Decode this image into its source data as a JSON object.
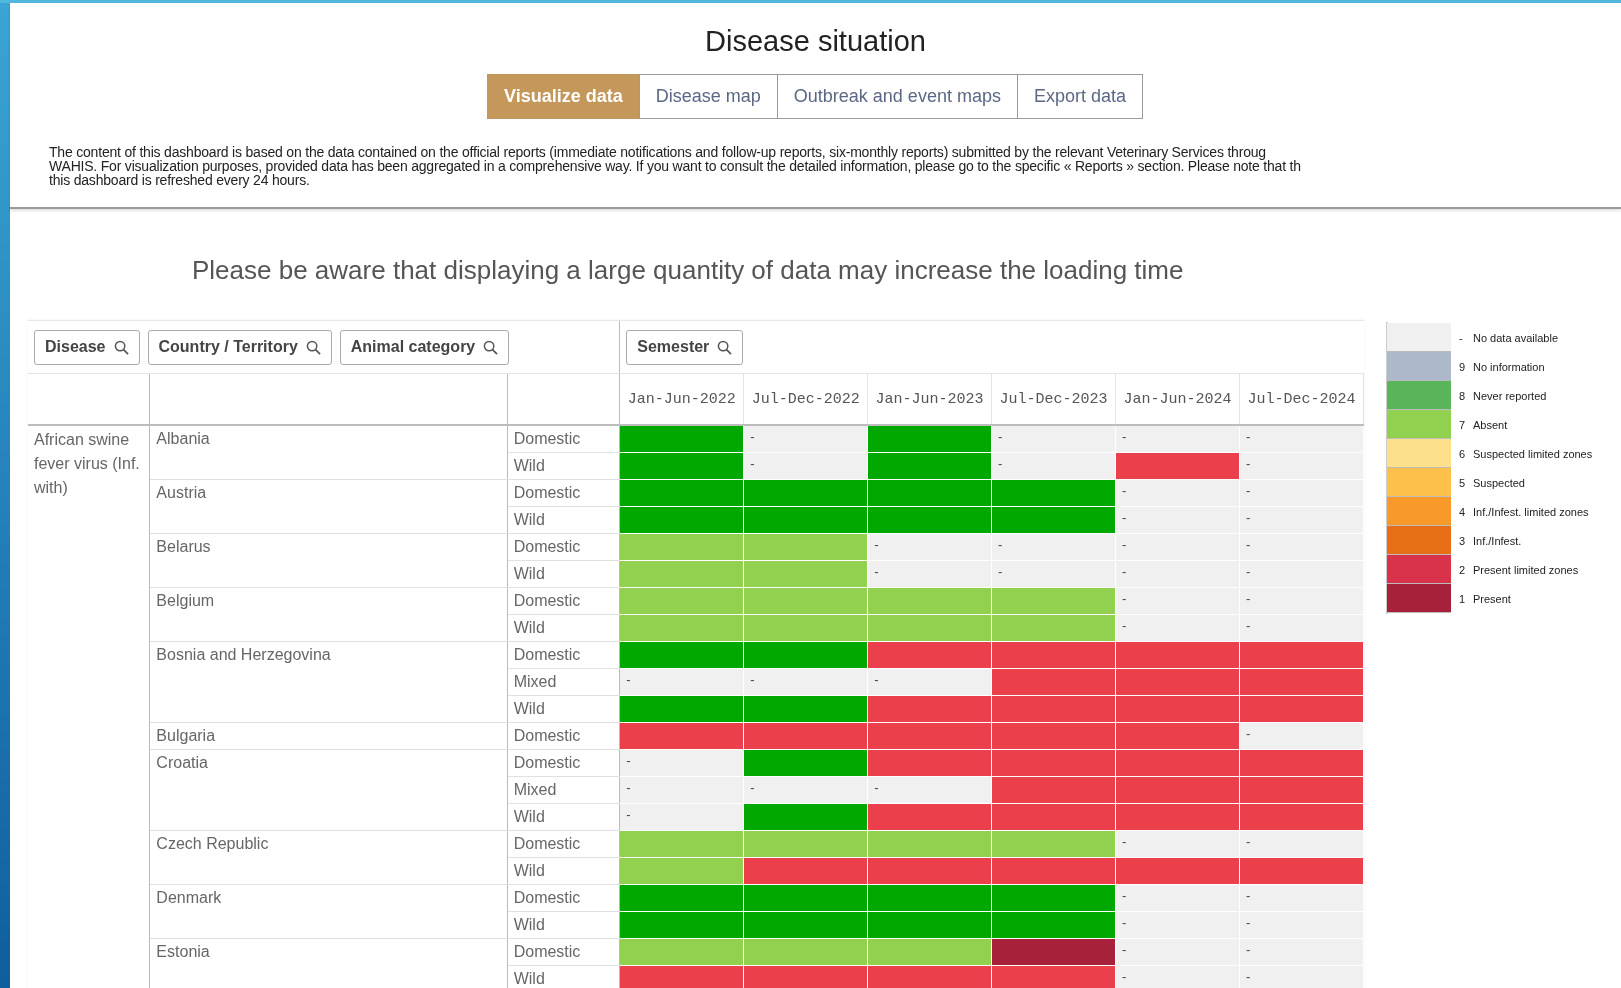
{
  "title": "Disease situation",
  "tabs": [
    {
      "label": "Visualize data",
      "selected": true
    },
    {
      "label": "Disease map",
      "selected": false
    },
    {
      "label": "Outbreak and event maps",
      "selected": false
    },
    {
      "label": "Export data",
      "selected": false
    }
  ],
  "description": [
    "The content of this dashboard is based on the data contained on the official reports (immediate notifications and follow-up reports, six-monthly reports) submitted by the relevant Veterinary Services throug",
    "WAHIS. For visualization purposes, provided data has been aggregated in a comprehensive way. If you want to consult the detailed information, please go to the specific « Reports » section. Please note that th",
    "this dashboard is refreshed every 24 hours."
  ],
  "notice": "Please be aware that displaying a large quantity of data may increase the loading time",
  "filters": [
    {
      "label": "Disease"
    },
    {
      "label": "Country / Territory"
    },
    {
      "label": "Animal category"
    }
  ],
  "semester_filter": {
    "label": "Semester"
  },
  "columns": [
    "Jan-Jun-2022",
    "Jul-Dec-2022",
    "Jan-Jun-2023",
    "Jul-Dec-2023",
    "Jan-Jun-2024",
    "Jul-Dec-2024"
  ],
  "table": {
    "disease": "African swine fever virus (Inf. with)",
    "countries": [
      {
        "name": "Albania",
        "rows": [
          {
            "category": "Domestic",
            "cells": [
              {
                "kind": "never_reported"
              },
              {
                "kind": "no_data",
                "text": "-"
              },
              {
                "kind": "never_reported"
              },
              {
                "kind": "no_data",
                "text": "-"
              },
              {
                "kind": "no_data",
                "text": "-"
              },
              {
                "kind": "no_data",
                "text": "-"
              }
            ]
          },
          {
            "category": "Wild",
            "cells": [
              {
                "kind": "never_reported"
              },
              {
                "kind": "no_data",
                "text": "-"
              },
              {
                "kind": "never_reported"
              },
              {
                "kind": "no_data",
                "text": "-"
              },
              {
                "kind": "present_limited"
              },
              {
                "kind": "no_data",
                "text": "-"
              }
            ]
          }
        ]
      },
      {
        "name": "Austria",
        "rows": [
          {
            "category": "Domestic",
            "cells": [
              {
                "kind": "never_reported"
              },
              {
                "kind": "never_reported"
              },
              {
                "kind": "never_reported"
              },
              {
                "kind": "never_reported"
              },
              {
                "kind": "no_data",
                "text": "-"
              },
              {
                "kind": "no_data",
                "text": "-"
              }
            ]
          },
          {
            "category": "Wild",
            "cells": [
              {
                "kind": "never_reported"
              },
              {
                "kind": "never_reported"
              },
              {
                "kind": "never_reported"
              },
              {
                "kind": "never_reported"
              },
              {
                "kind": "no_data",
                "text": "-"
              },
              {
                "kind": "no_data",
                "text": "-"
              }
            ]
          }
        ]
      },
      {
        "name": "Belarus",
        "rows": [
          {
            "category": "Domestic",
            "cells": [
              {
                "kind": "absent"
              },
              {
                "kind": "absent"
              },
              {
                "kind": "no_data",
                "text": "-"
              },
              {
                "kind": "no_data",
                "text": "-"
              },
              {
                "kind": "no_data",
                "text": "-"
              },
              {
                "kind": "no_data",
                "text": "-"
              }
            ]
          },
          {
            "category": "Wild",
            "cells": [
              {
                "kind": "absent"
              },
              {
                "kind": "absent"
              },
              {
                "kind": "no_data",
                "text": "-"
              },
              {
                "kind": "no_data",
                "text": "-"
              },
              {
                "kind": "no_data",
                "text": "-"
              },
              {
                "kind": "no_data",
                "text": "-"
              }
            ]
          }
        ]
      },
      {
        "name": "Belgium",
        "rows": [
          {
            "category": "Domestic",
            "cells": [
              {
                "kind": "absent"
              },
              {
                "kind": "absent"
              },
              {
                "kind": "absent"
              },
              {
                "kind": "absent"
              },
              {
                "kind": "no_data",
                "text": "-"
              },
              {
                "kind": "no_data",
                "text": "-"
              }
            ]
          },
          {
            "category": "Wild",
            "cells": [
              {
                "kind": "absent"
              },
              {
                "kind": "absent"
              },
              {
                "kind": "absent"
              },
              {
                "kind": "absent"
              },
              {
                "kind": "no_data",
                "text": "-"
              },
              {
                "kind": "no_data",
                "text": "-"
              }
            ]
          }
        ]
      },
      {
        "name": "Bosnia and Herzegovina",
        "rows": [
          {
            "category": "Domestic",
            "cells": [
              {
                "kind": "never_reported"
              },
              {
                "kind": "never_reported"
              },
              {
                "kind": "present_limited"
              },
              {
                "kind": "present_limited"
              },
              {
                "kind": "present_limited"
              },
              {
                "kind": "present_limited"
              }
            ]
          },
          {
            "category": "Mixed",
            "cells": [
              {
                "kind": "no_data",
                "text": "-"
              },
              {
                "kind": "no_data",
                "text": "-"
              },
              {
                "kind": "no_data",
                "text": "-"
              },
              {
                "kind": "present_limited"
              },
              {
                "kind": "present_limited"
              },
              {
                "kind": "present_limited"
              }
            ]
          },
          {
            "category": "Wild",
            "cells": [
              {
                "kind": "never_reported"
              },
              {
                "kind": "never_reported"
              },
              {
                "kind": "present_limited"
              },
              {
                "kind": "present_limited"
              },
              {
                "kind": "present_limited"
              },
              {
                "kind": "present_limited"
              }
            ]
          }
        ]
      },
      {
        "name": "Bulgaria",
        "rows": [
          {
            "category": "Domestic",
            "cells": [
              {
                "kind": "present_limited"
              },
              {
                "kind": "present_limited"
              },
              {
                "kind": "present_limited"
              },
              {
                "kind": "present_limited"
              },
              {
                "kind": "present_limited"
              },
              {
                "kind": "no_data",
                "text": "-"
              }
            ]
          }
        ]
      },
      {
        "name": "Croatia",
        "rows": [
          {
            "category": "Domestic",
            "cells": [
              {
                "kind": "no_data",
                "text": "-"
              },
              {
                "kind": "never_reported"
              },
              {
                "kind": "present_limited"
              },
              {
                "kind": "present_limited"
              },
              {
                "kind": "present_limited"
              },
              {
                "kind": "present_limited"
              }
            ]
          },
          {
            "category": "Mixed",
            "cells": [
              {
                "kind": "no_data",
                "text": "-"
              },
              {
                "kind": "no_data",
                "text": "-"
              },
              {
                "kind": "no_data",
                "text": "-"
              },
              {
                "kind": "present_limited"
              },
              {
                "kind": "present_limited"
              },
              {
                "kind": "present_limited"
              }
            ]
          },
          {
            "category": "Wild",
            "cells": [
              {
                "kind": "no_data",
                "text": "-"
              },
              {
                "kind": "never_reported"
              },
              {
                "kind": "present_limited"
              },
              {
                "kind": "present_limited"
              },
              {
                "kind": "present_limited"
              },
              {
                "kind": "present_limited"
              }
            ]
          }
        ]
      },
      {
        "name": "Czech Republic",
        "rows": [
          {
            "category": "Domestic",
            "cells": [
              {
                "kind": "absent"
              },
              {
                "kind": "absent"
              },
              {
                "kind": "absent"
              },
              {
                "kind": "absent"
              },
              {
                "kind": "no_data",
                "text": "-"
              },
              {
                "kind": "no_data",
                "text": "-"
              }
            ]
          },
          {
            "category": "Wild",
            "cells": [
              {
                "kind": "absent"
              },
              {
                "kind": "present_limited"
              },
              {
                "kind": "present_limited"
              },
              {
                "kind": "present_limited"
              },
              {
                "kind": "present_limited"
              },
              {
                "kind": "present_limited"
              }
            ]
          }
        ]
      },
      {
        "name": "Denmark",
        "rows": [
          {
            "category": "Domestic",
            "cells": [
              {
                "kind": "never_reported"
              },
              {
                "kind": "never_reported"
              },
              {
                "kind": "never_reported"
              },
              {
                "kind": "never_reported"
              },
              {
                "kind": "no_data",
                "text": "-"
              },
              {
                "kind": "no_data",
                "text": "-"
              }
            ]
          },
          {
            "category": "Wild",
            "cells": [
              {
                "kind": "never_reported"
              },
              {
                "kind": "never_reported"
              },
              {
                "kind": "never_reported"
              },
              {
                "kind": "never_reported"
              },
              {
                "kind": "no_data",
                "text": "-"
              },
              {
                "kind": "no_data",
                "text": "-"
              }
            ]
          }
        ]
      },
      {
        "name": "Estonia",
        "rows": [
          {
            "category": "Domestic",
            "cells": [
              {
                "kind": "absent"
              },
              {
                "kind": "absent"
              },
              {
                "kind": "absent"
              },
              {
                "kind": "present"
              },
              {
                "kind": "no_data",
                "text": "-"
              },
              {
                "kind": "no_data",
                "text": "-"
              }
            ]
          },
          {
            "category": "Wild",
            "cells": [
              {
                "kind": "present_limited"
              },
              {
                "kind": "present_limited"
              },
              {
                "kind": "present_limited"
              },
              {
                "kind": "present_limited"
              },
              {
                "kind": "no_data",
                "text": "-"
              },
              {
                "kind": "no_data",
                "text": "-"
              }
            ]
          }
        ]
      }
    ]
  },
  "legend": [
    {
      "code": "-",
      "label": "No data available",
      "color": "#f0f0f0"
    },
    {
      "code": "9",
      "label": "No information",
      "color": "#adb9ca"
    },
    {
      "code": "8",
      "label": "Never reported",
      "color": "#58b55a"
    },
    {
      "code": "7",
      "label": "Absent",
      "color": "#92d050"
    },
    {
      "code": "6",
      "label": "Suspected limited zones",
      "color": "#fde08c"
    },
    {
      "code": "5",
      "label": "Suspected",
      "color": "#fdc04a"
    },
    {
      "code": "4",
      "label": "Inf./Infest. limited zones",
      "color": "#f79a2a"
    },
    {
      "code": "3",
      "label": "Inf./Infest.",
      "color": "#e96e18"
    },
    {
      "code": "2",
      "label": "Present limited zones",
      "color": "#d8334a"
    },
    {
      "code": "1",
      "label": "Present",
      "color": "#a8213a"
    }
  ]
}
